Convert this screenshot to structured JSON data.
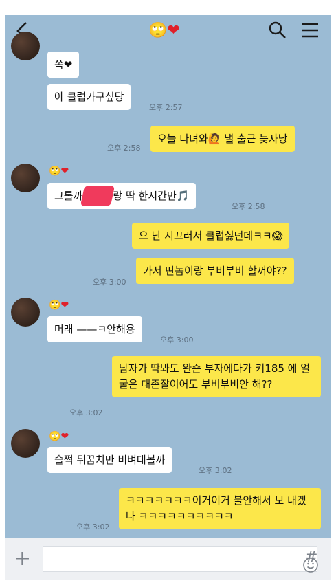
{
  "header": {
    "title_emoji": "🙄",
    "title_heart": "❤",
    "back_icon": "chevron-left",
    "search_icon": "magnifier",
    "menu_icon": "hamburger"
  },
  "sender_name": {
    "emoji": "🙄",
    "heart": "❤"
  },
  "messages": [
    {
      "text": "쪽❤"
    },
    {
      "text": "아 클럽가구싶당",
      "time": "오후 2:57"
    },
    {
      "text": "오늘 다녀와🙋 낼 출근 늦자낭",
      "time": "오후 2:58"
    },
    {
      "text_before": "그롤까",
      "text_after": "랑 딱 한시간만🎵",
      "time": "오후 2:58"
    },
    {
      "text": "으 난 시끄러서 클럽싫던데ㅋㅋ😱"
    },
    {
      "text": "가서 딴놈이랑 부비부비 할꺼야??",
      "time": "오후 3:00"
    },
    {
      "text": "머래 ——ㅋ안해용",
      "time": "오후 3:00"
    },
    {
      "text": "남자가 딱봐도 완죤 부자에다가 키185 에 얼굴은 대존잘이어도 부비부비안 해??",
      "time": "오후 3:02"
    },
    {
      "text": "슬쩍 뒤꿈치만 비벼대볼까",
      "time": "오후 3:02"
    },
    {
      "text": "ㅋㅋㅋㅋㅋㅋㅋ이거이거 불안해서 보 내겠나 ㅋㅋㅋㅋㅋㅋㅋㅋㅋㅋ",
      "time": "오후 3:02"
    }
  ],
  "input_bar": {
    "plus_label": "+",
    "hash_label": "#",
    "emoji_icon": "smiley"
  },
  "colors": {
    "background": "#9bbbd4",
    "my_bubble": "#fce74a",
    "their_bubble": "#ffffff"
  }
}
